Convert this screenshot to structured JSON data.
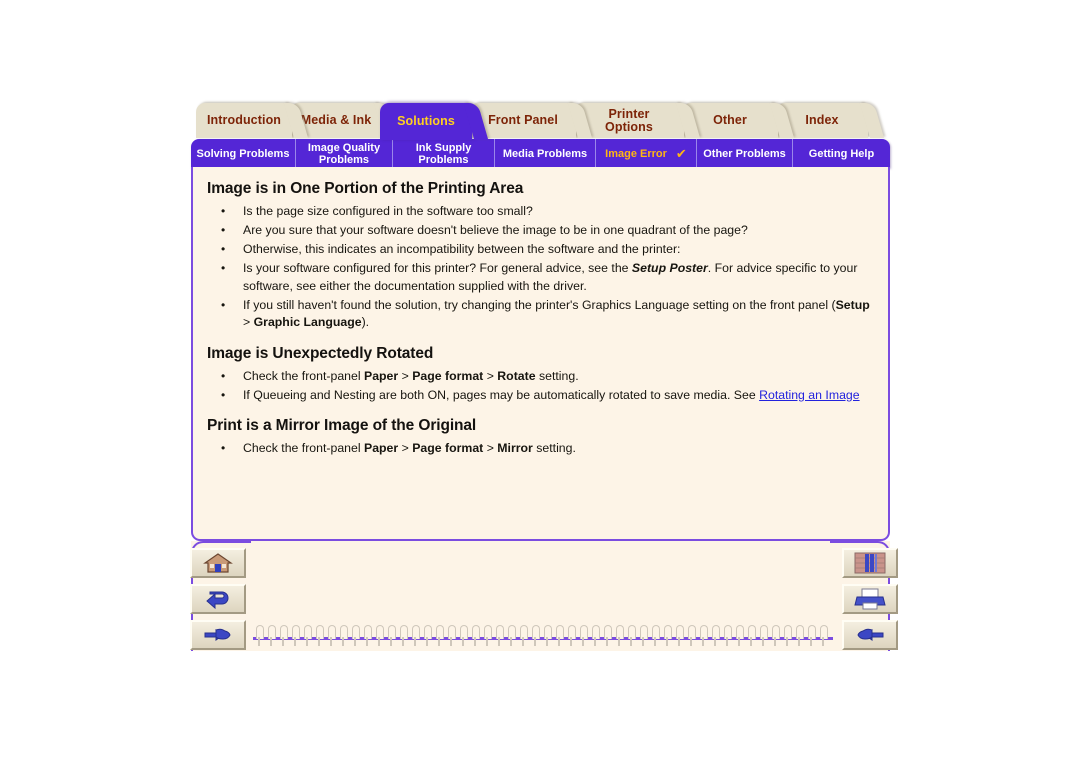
{
  "document": {
    "type": "printer-user-guide",
    "background_color": "#ffffff",
    "page_color": "#fdf4e7",
    "accent_purple": "#5426d6",
    "accent_gold": "#ffcf21",
    "tab_beige": "#e6e0cc",
    "tab_text_color": "#7d2408",
    "link_color": "#2222dd"
  },
  "top_tabs": [
    {
      "label": "Introduction",
      "active": false
    },
    {
      "label": "Media & Ink",
      "active": false
    },
    {
      "label": "Solutions",
      "active": true
    },
    {
      "label": "Front Panel",
      "active": false
    },
    {
      "label": "Printer Options",
      "active": false
    },
    {
      "label": "Other",
      "active": false
    },
    {
      "label": "Index",
      "active": false
    }
  ],
  "sub_tabs": [
    {
      "label": "Solving Problems",
      "selected": false,
      "check": ""
    },
    {
      "label": "Image Quality Problems",
      "selected": false,
      "check": ""
    },
    {
      "label": "Ink Supply Problems",
      "selected": false,
      "check": ""
    },
    {
      "label": "Media Problems",
      "selected": false,
      "check": ""
    },
    {
      "label": "Image Error",
      "selected": true,
      "check": "✔"
    },
    {
      "label": "Other Problems",
      "selected": false,
      "check": ""
    },
    {
      "label": "Getting Help",
      "selected": false,
      "check": ""
    }
  ],
  "content": {
    "sections": [
      {
        "heading": "Image is in One Portion of the Printing Area",
        "bullets": [
          {
            "runs": [
              {
                "t": "Is the page size configured in the software too small?",
                "s": "n"
              }
            ]
          },
          {
            "runs": [
              {
                "t": "Are you sure that your software doesn't believe the image to be in one quadrant of the page?",
                "s": "n"
              }
            ]
          },
          {
            "runs": [
              {
                "t": "Otherwise, this indicates an incompatibility between the software and the printer:",
                "s": "n"
              }
            ]
          },
          {
            "runs": [
              {
                "t": "Is your software configured for this printer? For general advice, see the ",
                "s": "n"
              },
              {
                "t": "Setup Poster",
                "s": "bi"
              },
              {
                "t": ". For advice specific to your software, see either the documentation supplied with the driver.",
                "s": "n"
              }
            ]
          },
          {
            "runs": [
              {
                "t": "If you still haven't found the solution, try changing the printer's Graphics Language setting on the front panel (",
                "s": "n"
              },
              {
                "t": "Setup",
                "s": "b"
              },
              {
                "t": " > ",
                "s": "n"
              },
              {
                "t": "Graphic Language",
                "s": "b"
              },
              {
                "t": ").",
                "s": "n"
              }
            ]
          }
        ]
      },
      {
        "heading": "Image is Unexpectedly Rotated",
        "bullets": [
          {
            "runs": [
              {
                "t": "Check the front-panel ",
                "s": "n"
              },
              {
                "t": "Paper",
                "s": "b"
              },
              {
                "t": " > ",
                "s": "n"
              },
              {
                "t": "Page format",
                "s": "b"
              },
              {
                "t": " > ",
                "s": "n"
              },
              {
                "t": "Rotate",
                "s": "b"
              },
              {
                "t": " setting.",
                "s": "n"
              }
            ]
          },
          {
            "runs": [
              {
                "t": "If Queueing and Nesting are both ON, pages may be automatically rotated to save media. See ",
                "s": "n"
              },
              {
                "t": "Rotating an Image",
                "s": "link"
              }
            ]
          }
        ]
      },
      {
        "heading": "Print is a Mirror Image of the Original",
        "bullets": [
          {
            "runs": [
              {
                "t": "Check the front-panel ",
                "s": "n"
              },
              {
                "t": "Paper",
                "s": "b"
              },
              {
                "t": " > ",
                "s": "n"
              },
              {
                "t": "Page format",
                "s": "b"
              },
              {
                "t": " > ",
                "s": "n"
              },
              {
                "t": "Mirror",
                "s": "b"
              },
              {
                "t": " setting.",
                "s": "n"
              }
            ]
          }
        ]
      }
    ]
  },
  "nav": {
    "left": [
      {
        "icon": "home-icon",
        "title": "Home"
      },
      {
        "icon": "back-arrow-icon",
        "title": "Back"
      },
      {
        "icon": "hand-right-icon",
        "title": "Next page"
      }
    ],
    "right": [
      {
        "icon": "bookshelf-icon",
        "title": "Index"
      },
      {
        "icon": "printer-icon",
        "title": "Print"
      },
      {
        "icon": "hand-left-icon",
        "title": "Previous page"
      }
    ]
  },
  "binding": {
    "rings": 48
  }
}
